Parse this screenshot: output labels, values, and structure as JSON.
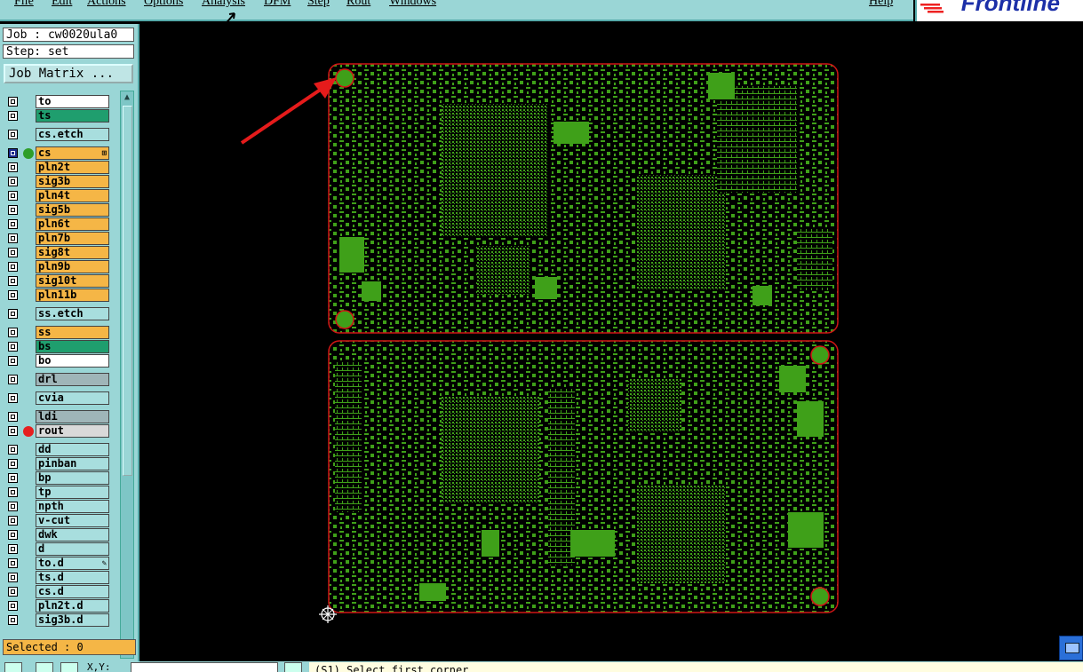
{
  "menubar": {
    "items": [
      "File",
      "Edit",
      "Actions",
      "Options",
      "Analysis",
      "DFM",
      "Step",
      "Rout",
      "Windows"
    ],
    "help": "Help"
  },
  "brand": {
    "name": "Frontline"
  },
  "job_panel": {
    "job_line": "Job : cw0020ula0",
    "step_line": "Step: set",
    "job_matrix_button": "Job Matrix ..."
  },
  "layers": [
    {
      "name": "to",
      "color": "#ffffff",
      "checked": false,
      "dot": null
    },
    {
      "name": "ts",
      "color": "#1f9e6e",
      "checked": false,
      "dot": null
    },
    {
      "name": "cs.etch",
      "color": "#a8dede",
      "checked": false,
      "dot": null
    },
    {
      "name": "cs",
      "color": "#f5b646",
      "checked": true,
      "dot": "#2f9e2a",
      "suffix": "⊞"
    },
    {
      "name": "pln2t",
      "color": "#f5b646",
      "checked": false,
      "dot": null
    },
    {
      "name": "sig3b",
      "color": "#f5b646",
      "checked": false,
      "dot": null
    },
    {
      "name": "pln4t",
      "color": "#f5b646",
      "checked": false,
      "dot": null
    },
    {
      "name": "sig5b",
      "color": "#f5b646",
      "checked": false,
      "dot": null
    },
    {
      "name": "pln6t",
      "color": "#f5b646",
      "checked": false,
      "dot": null
    },
    {
      "name": "pln7b",
      "color": "#f5b646",
      "checked": false,
      "dot": null
    },
    {
      "name": "sig8t",
      "color": "#f5b646",
      "checked": false,
      "dot": null
    },
    {
      "name": "pln9b",
      "color": "#f5b646",
      "checked": false,
      "dot": null
    },
    {
      "name": "sig10t",
      "color": "#f5b646",
      "checked": false,
      "dot": null
    },
    {
      "name": "pln11b",
      "color": "#f5b646",
      "checked": false,
      "dot": null
    },
    {
      "name": "ss.etch",
      "color": "#a8dede",
      "checked": false,
      "dot": null
    },
    {
      "name": "ss",
      "color": "#f5b646",
      "checked": false,
      "dot": null
    },
    {
      "name": "bs",
      "color": "#1f9e6e",
      "checked": false,
      "dot": null
    },
    {
      "name": "bo",
      "color": "#ffffff",
      "checked": false,
      "dot": null
    },
    {
      "name": "drl",
      "color": "#9fb5b8",
      "checked": false,
      "dot": null
    },
    {
      "name": "cvia",
      "color": "#a8dede",
      "checked": false,
      "dot": null
    },
    {
      "name": "ldi",
      "color": "#9fb5b8",
      "checked": false,
      "dot": null
    },
    {
      "name": "rout",
      "color": "#d9d9d9",
      "checked": false,
      "dot": "#e62020"
    },
    {
      "name": "dd",
      "color": "#a8dede",
      "checked": false,
      "dot": null
    },
    {
      "name": "pinban",
      "color": "#a8dede",
      "checked": false,
      "dot": null
    },
    {
      "name": "bp",
      "color": "#a8dede",
      "checked": false,
      "dot": null
    },
    {
      "name": "tp",
      "color": "#a8dede",
      "checked": false,
      "dot": null
    },
    {
      "name": "npth",
      "color": "#a8dede",
      "checked": false,
      "dot": null
    },
    {
      "name": "v-cut",
      "color": "#a8dede",
      "checked": false,
      "dot": null
    },
    {
      "name": "dwk",
      "color": "#a8dede",
      "checked": false,
      "dot": null
    },
    {
      "name": "d",
      "color": "#a8dede",
      "checked": false,
      "dot": null
    },
    {
      "name": "to.d",
      "color": "#a8dede",
      "checked": false,
      "dot": null,
      "suffix": "✎"
    },
    {
      "name": "ts.d",
      "color": "#a8dede",
      "checked": false,
      "dot": null
    },
    {
      "name": "cs.d",
      "color": "#a8dede",
      "checked": false,
      "dot": null
    },
    {
      "name": "pln2t.d",
      "color": "#a8dede",
      "checked": false,
      "dot": null
    },
    {
      "name": "sig3b.d",
      "color": "#a8dede",
      "checked": false,
      "dot": null
    }
  ],
  "status": {
    "selected": "Selected : 0"
  },
  "bottom": {
    "xy_label": "X,Y:",
    "message": "(S1)   Select first corner"
  },
  "colors": {
    "panel": "#9ad6d6",
    "board_fill": "#3fa019",
    "board_outline": "#d01515",
    "arrow": "#e51b1b"
  },
  "icons": [
    "arrow-cursor-icon",
    "crosshair-icon",
    "scroll-up-icon",
    "scroll-down-icon"
  ]
}
